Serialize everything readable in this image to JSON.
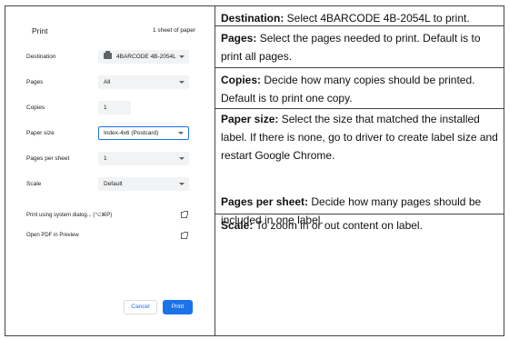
{
  "dialog": {
    "title": "Print",
    "sheets": "1 sheet of paper",
    "rows": {
      "destination": {
        "label": "Destination",
        "value": "4BARCODE 4B-2054L"
      },
      "pages": {
        "label": "Pages",
        "value": "All"
      },
      "copies": {
        "label": "Copies",
        "value": "1"
      },
      "paper_size": {
        "label": "Paper size",
        "value": "Index-4x6 (Postcard)"
      },
      "pages_per_sheet": {
        "label": "Pages per sheet",
        "value": "1"
      },
      "scale": {
        "label": "Scale",
        "value": "Default"
      }
    },
    "system_dialog_link": "Print using system dialog... (⌥⌘P)",
    "preview_link": "Open PDF in Preview",
    "cancel_label": "Cancel",
    "print_label": "Print",
    "accent_color": "#1a73e8"
  },
  "descriptions": [
    {
      "term": "Destination:",
      "text": " Select 4BARCODE 4B-2054L to print."
    },
    {
      "term": "Pages:",
      "text": " Select the pages needed to print. Default is to print all pages."
    },
    {
      "term": "Copies:",
      "text": " Decide how many copies should be printed. Default is to print one copy."
    },
    {
      "term": "Paper size:",
      "text": " Select the size that matched the installed label. If there is none, go to driver to create label size and restart Google Chrome."
    },
    {
      "term": "Pages per sheet:",
      "text": " Decide how many pages should be included in one label."
    },
    {
      "term": "Scale:",
      "text": " To zoom in or out content on label."
    }
  ]
}
